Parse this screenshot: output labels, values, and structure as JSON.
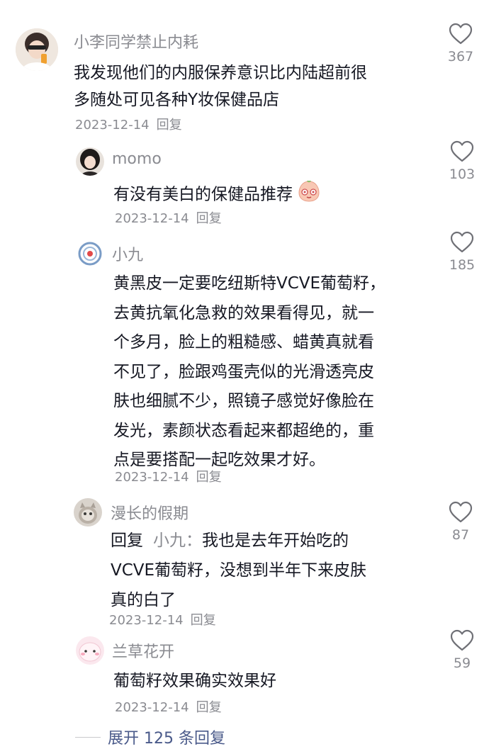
{
  "comments": [
    {
      "username": "小李同学禁止内耗",
      "text_lines": [
        "我发现他们的内服保养意识比内陆超前很",
        "多随处可见各种Y妆保健品店"
      ],
      "date": "2023-12-14",
      "reply_label": "回复",
      "likes": "367"
    },
    {
      "username": "momo",
      "text_lines": [
        "有没有美白的保健品推荐"
      ],
      "date": "2023-12-14",
      "reply_label": "回复",
      "likes": "103"
    },
    {
      "username": "小九",
      "text_lines": [
        "黄黑皮一定要吃纽斯特VCVE葡萄籽，",
        "去黄抗氧化急救的效果看得见，就一",
        "个多月，脸上的粗糙感、蜡黄真就看",
        "不见了，脸跟鸡蛋壳似的光滑透亮皮",
        "肤也细腻不少，照镜子感觉好像脸在",
        "发光，素颜状态看起来都超绝的，重",
        "点是要搭配一起吃效果才好。"
      ],
      "date": "2023-12-14",
      "reply_label": "回复",
      "likes": "185"
    },
    {
      "username": "漫长的假期",
      "reply_prefix": "回复",
      "reply_target": "小九：",
      "text_first": "我也是去年开始吃的",
      "text_lines": [
        "VCVE葡萄籽，没想到半年下来皮肤",
        "真的白了"
      ],
      "date": "2023-12-14",
      "reply_label": "回复",
      "likes": "87"
    },
    {
      "username": "兰草花开",
      "text_lines": [
        "葡萄籽效果确实效果好"
      ],
      "date": "2023-12-14",
      "reply_label": "回复",
      "likes": "59"
    }
  ],
  "expand_label": "展开 125 条回复",
  "icons": {
    "like": "heart-outline-icon",
    "emoji": "blushing-face-emoji"
  },
  "colors": {
    "text": "#161823",
    "muted": "#8a8b91",
    "link": "#4a5a8a"
  }
}
